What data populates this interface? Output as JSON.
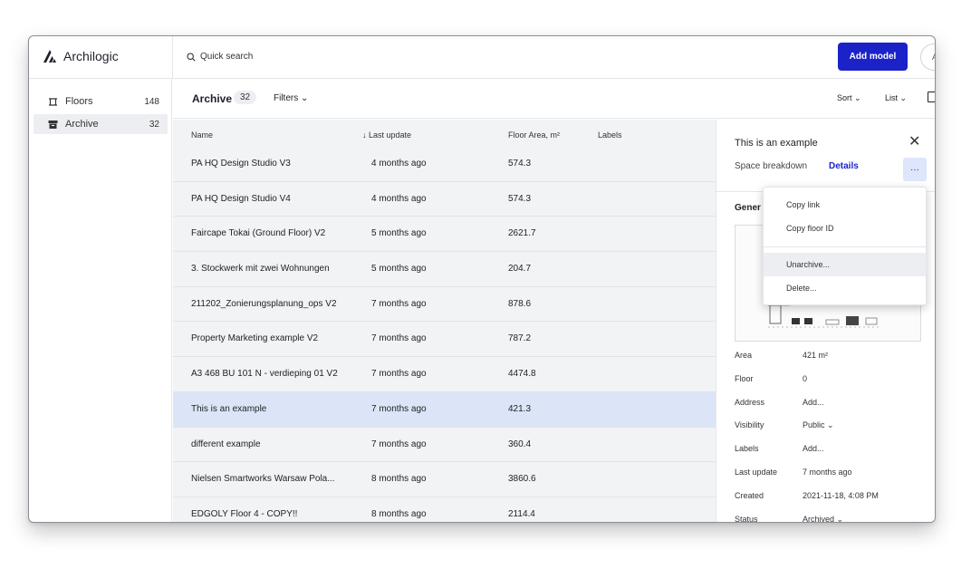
{
  "app": {
    "name": "Archilogic"
  },
  "header": {
    "search_placeholder": "Quick search",
    "add_button_label": "Add model",
    "avatar_initial": "A"
  },
  "sidebar": {
    "items": [
      {
        "label": "Floors",
        "count": "148"
      },
      {
        "label": "Archive",
        "count": "32"
      }
    ]
  },
  "toolbar": {
    "title": "Archive",
    "count": "32",
    "filters_label": "Filters",
    "sort_label": "Sort",
    "view_label": "List"
  },
  "table": {
    "columns": [
      "Name",
      "↓ Last update",
      "Floor Area, m²",
      "Labels"
    ],
    "rows": [
      {
        "name": "PA HQ Design Studio V3",
        "updated": "4 months ago",
        "area": "574.3",
        "selected": false
      },
      {
        "name": "PA HQ Design Studio V4",
        "updated": "4 months ago",
        "area": "574.3",
        "selected": false
      },
      {
        "name": "Faircape Tokai (Ground Floor) V2",
        "updated": "5 months ago",
        "area": "2621.7",
        "selected": false
      },
      {
        "name": "3. Stockwerk mit zwei Wohnungen",
        "updated": "5 months ago",
        "area": "204.7",
        "selected": false
      },
      {
        "name": "211202_Zonierungsplanung_ops V2",
        "updated": "7 months ago",
        "area": "878.6",
        "selected": false
      },
      {
        "name": "Property Marketing example V2",
        "updated": "7 months ago",
        "area": "787.2",
        "selected": false
      },
      {
        "name": "A3 468 BU 101 N - verdieping 01 V2",
        "updated": "7 months ago",
        "area": "4474.8",
        "selected": false
      },
      {
        "name": "This is an example",
        "updated": "7 months ago",
        "area": "421.3",
        "selected": true
      },
      {
        "name": "different example",
        "updated": "7 months ago",
        "area": "360.4",
        "selected": false
      },
      {
        "name": "Nielsen Smartworks Warsaw Pola...",
        "updated": "8 months ago",
        "area": "3860.6",
        "selected": false
      },
      {
        "name": "EDGOLY Floor 4 - COPY!!",
        "updated": "8 months ago",
        "area": "2114.4",
        "selected": false
      }
    ]
  },
  "panel": {
    "title": "This is an example",
    "tabs": [
      "Space breakdown",
      "Details"
    ],
    "more_label": "···",
    "section_title": "Gener",
    "fields": [
      {
        "key": "Area",
        "value": "421 m²"
      },
      {
        "key": "Floor",
        "value": "0"
      },
      {
        "key": "Address",
        "value": "Add..."
      },
      {
        "key": "Visibility",
        "value": "Public ⌄"
      },
      {
        "key": "Labels",
        "value": "Add..."
      },
      {
        "key": "Last update",
        "value": "7 months ago"
      },
      {
        "key": "Created",
        "value": "2021-11-18, 4:08 PM"
      },
      {
        "key": "Status",
        "value": "Archived ⌄"
      }
    ]
  },
  "menu": {
    "items": [
      "Copy link",
      "Copy floor ID",
      "Unarchive...",
      "Delete..."
    ],
    "highlighted_index": 2
  },
  "colors": {
    "accent": "#1a22c8",
    "selected_row": "#dbe5f7",
    "row_bg": "#f2f3f5"
  }
}
